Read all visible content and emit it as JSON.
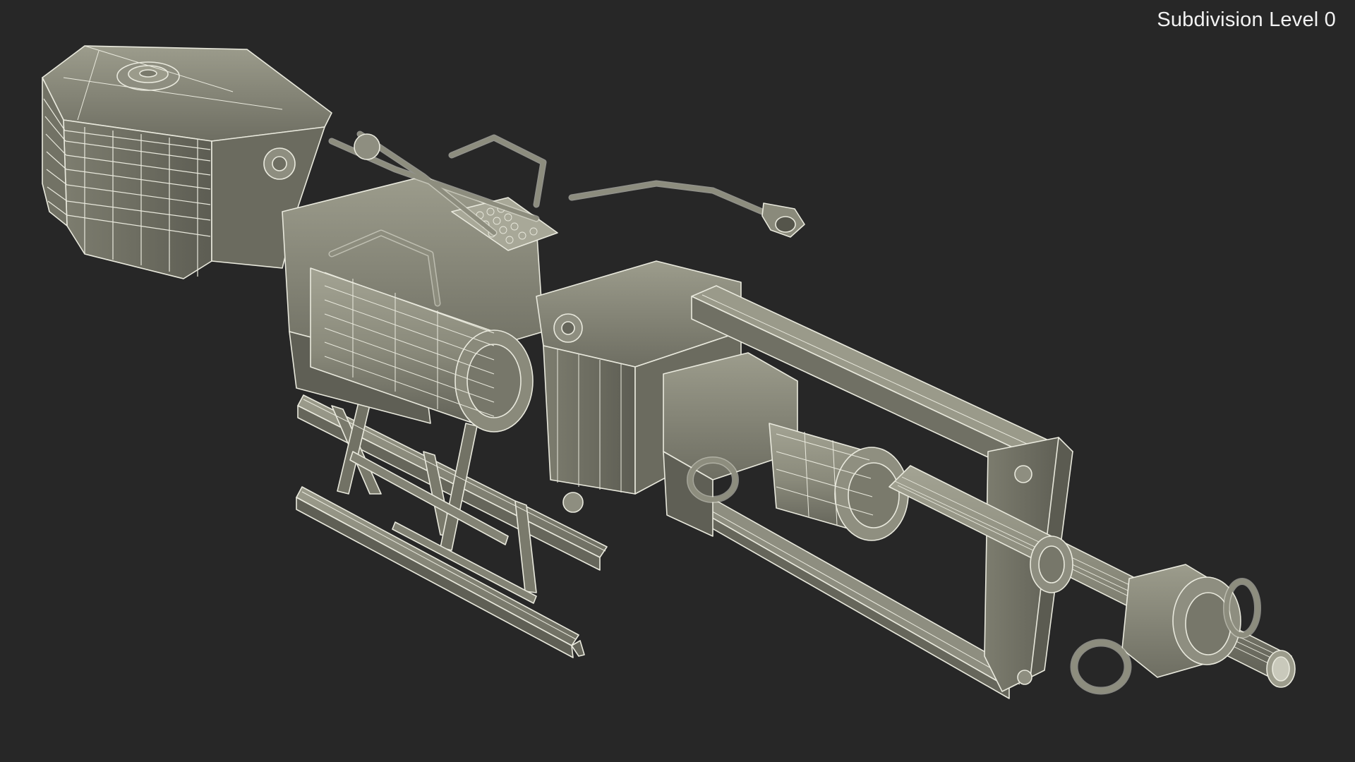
{
  "viewport": {
    "label": "Subdivision Level 0",
    "background_color": "#272727"
  },
  "model": {
    "surface_color": "#8d8d7e",
    "wire_color": "#e9e9dd",
    "shadow_color": "#55554b"
  }
}
